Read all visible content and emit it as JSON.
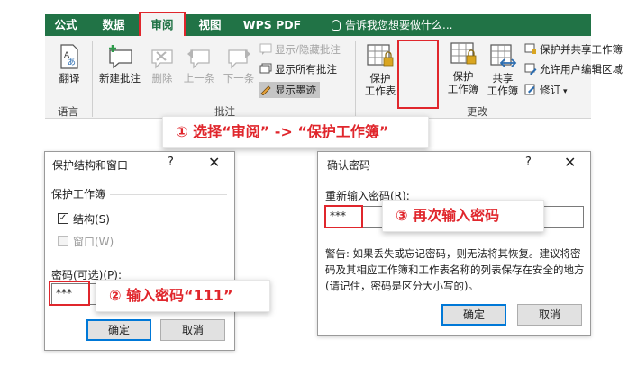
{
  "tabs": [
    "公式",
    "数据",
    "审阅",
    "视图",
    "WPS PDF"
  ],
  "tell_me": "告诉我您想要做什么...",
  "ribbon": {
    "translate": "翻译",
    "new_comment": "新建批注",
    "delete": "删除",
    "previous": "上一条",
    "next": "下一条",
    "show_hide_comment": "显示/隐藏批注",
    "show_all_comments": "显示所有批注",
    "show_ink": "显示墨迹",
    "protect_sheet_1": "保护",
    "protect_sheet_2": "工作表",
    "protect_workbook_1": "保护",
    "protect_workbook_2": "工作簿",
    "share_workbook_1": "共享",
    "share_workbook_2": "工作簿",
    "protect_and_share": "保护并共享工作簿",
    "allow_edit_ranges": "允许用户编辑区域",
    "track_changes": "修订",
    "group_language": "语言",
    "group_comments": "批注",
    "group_changes": "更改"
  },
  "callouts": {
    "step1": "① 选择“审阅” -> “保护工作簿”",
    "step2": "② 输入密码“111”",
    "step3": "③ 再次输入密码"
  },
  "dialog1": {
    "title": "保护结构和窗口",
    "help": "?",
    "close": "✕",
    "section": "保护工作簿",
    "structure": "结构(S)",
    "windows": "窗口(W)",
    "password_label": "密码(可选)(P):",
    "password_value": "***",
    "ok": "确定",
    "cancel": "取消"
  },
  "dialog2": {
    "title": "确认密码",
    "help": "?",
    "close": "✕",
    "reenter_label": "重新输入密码(R):",
    "password_value": "***",
    "warning": "警告: 如果丢失或忘记密码，则无法将其恢复。建议将密码及其相应工作簿和工作表名称的列表保存在安全的地方(请记住，密码是区分大小写的)。",
    "ok": "确定",
    "cancel": "取消"
  },
  "colors": {
    "excel_green": "#217346",
    "highlight_red": "#e0262c",
    "default_button_blue": "#0078d7"
  }
}
